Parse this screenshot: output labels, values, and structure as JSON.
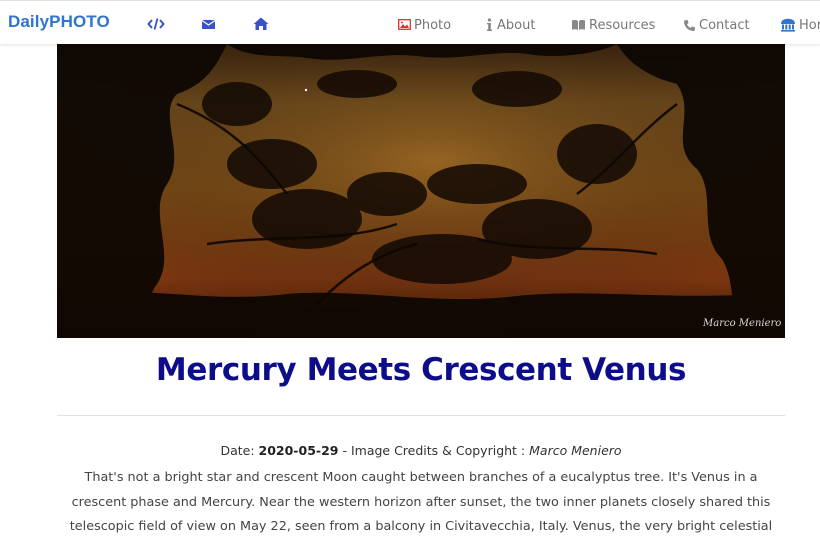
{
  "nav": {
    "brand": "DailyPHOTO",
    "icons": [
      "code-icon",
      "envelope-icon",
      "home-icon"
    ],
    "links": [
      {
        "label": "Photo",
        "icon": "image-icon"
      },
      {
        "label": "About",
        "icon": "info-icon"
      },
      {
        "label": "Resources",
        "icon": "book-icon"
      },
      {
        "label": "Contact",
        "icon": "phone-icon"
      },
      {
        "label": "Hor",
        "icon": "university-icon"
      }
    ]
  },
  "photo": {
    "signature": "Marco Meniero"
  },
  "article": {
    "title": "Mercury Meets Crescent Venus",
    "date_label": "Date:",
    "date": "2020-05-29",
    "credit_label": "- Image Credits & Copyright :",
    "author": "Marco Meniero",
    "description": "That's not a bright star and crescent Moon caught between branches of a eucalyptus tree. It's Venus in a crescent phase and Mercury. Near the western horizon after sunset, the two inner planets closely shared this telescopic field of view on May 22, seen from a balcony in Civitavecchia, Italy. Venus, the very bright celestial beacon, is wandering lower into the evening"
  },
  "colors": {
    "brand": "#2f74d0",
    "nav_icon": "#3a52c8",
    "title": "#0d0d8a",
    "photo_icon": "#e03030"
  }
}
